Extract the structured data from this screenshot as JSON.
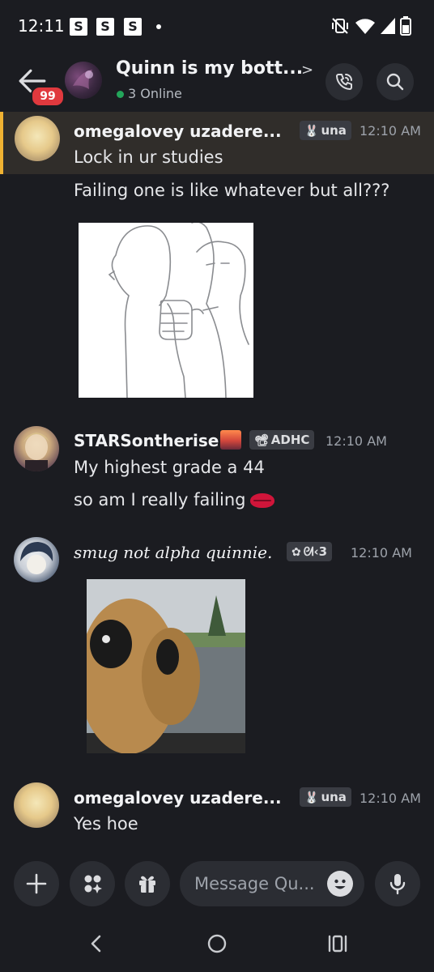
{
  "status_bar": {
    "time": "12:11",
    "notification_icons": [
      "S",
      "S",
      "S"
    ]
  },
  "header": {
    "badge_count": "99",
    "channel_title": "Quinn is my bott...",
    "online_text": "3 Online",
    "online_color": "#23a55a"
  },
  "messages": [
    {
      "username": "omegalovey uzadere...",
      "tag": "una",
      "tag_icon": "🐰",
      "timestamp": "12:10 AM",
      "lines": [
        "Lock in ur studies",
        "Failing one is like whatever but all???"
      ],
      "highlighted": true
    },
    {
      "username": "STARSontherise",
      "tag": "ADHC",
      "tag_icon": "📽",
      "timestamp": "12:10 AM",
      "lines": [
        "My highest grade a 44",
        "so am I really failing"
      ]
    },
    {
      "username": "smug not alpha quinnie.",
      "tag": "ᘛ‹3",
      "tag_icon": "✿",
      "timestamp": "12:10 AM",
      "lines": []
    },
    {
      "username": "omegalovey uzadere...",
      "tag": "una",
      "tag_icon": "🐰",
      "timestamp": "12:10 AM",
      "lines": [
        "Yes hoe"
      ]
    }
  ],
  "composer": {
    "placeholder": "Message Qu..."
  },
  "colors": {
    "background": "#1b1c21",
    "highlight_bar": "#f0b232",
    "badge": "#e0393e",
    "button_bg": "#2b2d33"
  }
}
